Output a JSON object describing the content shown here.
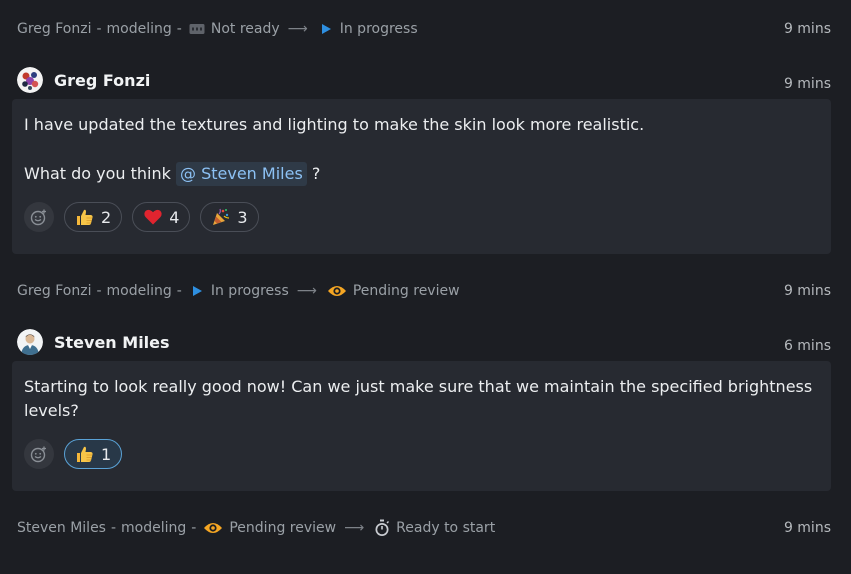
{
  "events": [
    {
      "author": "Greg Fonzi",
      "task": "modeling",
      "from_status": {
        "label": "Not ready",
        "icon": "not-ready-icon"
      },
      "to_status": {
        "label": "In progress",
        "icon": "play-icon"
      },
      "time": "9 mins"
    },
    {
      "author": "Greg Fonzi",
      "task": "modeling",
      "from_status": {
        "label": "In progress",
        "icon": "play-icon"
      },
      "to_status": {
        "label": "Pending review",
        "icon": "eye-icon"
      },
      "time": "9 mins"
    },
    {
      "author": "Steven Miles",
      "task": "modeling",
      "from_status": {
        "label": "Pending review",
        "icon": "eye-icon"
      },
      "to_status": {
        "label": "Ready to start",
        "icon": "stopwatch-icon"
      },
      "time": "9 mins"
    }
  ],
  "comments": [
    {
      "author": "Greg Fonzi",
      "time": "9 mins",
      "paragraph1": "I have updated the textures and lighting to make the skin look more realistic.",
      "paragraph2_prefix": "What do you think",
      "mention": "@ Steven Miles",
      "paragraph2_suffix": "?",
      "reactions": [
        {
          "emoji": "thumbs-up",
          "count": "2"
        },
        {
          "emoji": "heart",
          "count": "4"
        },
        {
          "emoji": "party-popper",
          "count": "3"
        }
      ]
    },
    {
      "author": "Steven Miles",
      "time": "6 mins",
      "text": "Starting to look really good now! Can we just make sure that we maintain the specified brightness levels?",
      "reactions": [
        {
          "emoji": "thumbs-up",
          "count": "1",
          "active": true
        }
      ]
    }
  ],
  "separator": "-",
  "colors": {
    "background": "#1c1e23",
    "card": "#272a31",
    "play": "#2e8fe0",
    "eye": "#f5a623",
    "mention_bg": "#2f3a47",
    "mention_text": "#8cc1f4",
    "active_reaction_border": "#5aa2d6"
  }
}
